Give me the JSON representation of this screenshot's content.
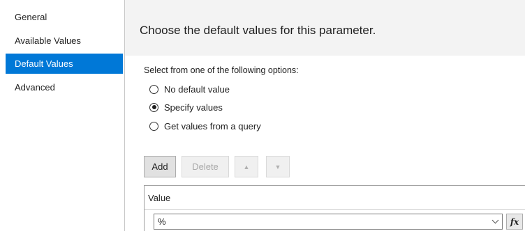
{
  "sidebar": {
    "items": [
      {
        "label": "General"
      },
      {
        "label": "Available Values"
      },
      {
        "label": "Default Values"
      },
      {
        "label": "Advanced"
      }
    ],
    "selected": "Default Values",
    "selected_color": "#0078d7"
  },
  "main": {
    "heading": "Choose the default values for this parameter.",
    "options_label": "Select from one of the following options:",
    "options": [
      {
        "label": "No default value",
        "checked": false
      },
      {
        "label": "Specify values",
        "checked": true
      },
      {
        "label": "Get values from a query",
        "checked": false
      }
    ]
  },
  "toolbar": {
    "add_label": "Add",
    "delete_label": "Delete",
    "delete_enabled": false,
    "move_up_icon": "arrow-up-icon",
    "move_down_icon": "arrow-down-icon",
    "move_up_enabled": false,
    "move_down_enabled": false
  },
  "grid": {
    "column_header": "Value",
    "rows": [
      {
        "value": "%"
      }
    ],
    "expression_button": "fx"
  }
}
